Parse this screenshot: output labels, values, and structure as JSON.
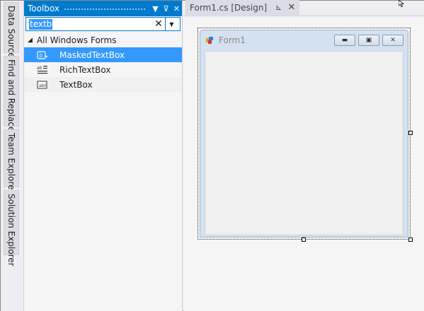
{
  "side_tabs": [
    "Data Sources",
    "Find and Replace",
    "Team Explorer",
    "Solution Explorer"
  ],
  "toolbox": {
    "title": "Toolbox",
    "search_value": "textb",
    "group_label": "All Windows Forms",
    "items": [
      {
        "label": "MaskedTextBox",
        "icon": "masked-textbox-icon",
        "selected": true
      },
      {
        "label": "RichTextBox",
        "icon": "richtextbox-icon",
        "selected": false
      },
      {
        "label": "TextBox",
        "icon": "textbox-icon",
        "selected": false
      }
    ]
  },
  "document": {
    "tab_label": "Form1.cs [Design]"
  },
  "form": {
    "title": "Form1"
  },
  "colors": {
    "accent": "#007acc",
    "selection": "#3399ff"
  }
}
